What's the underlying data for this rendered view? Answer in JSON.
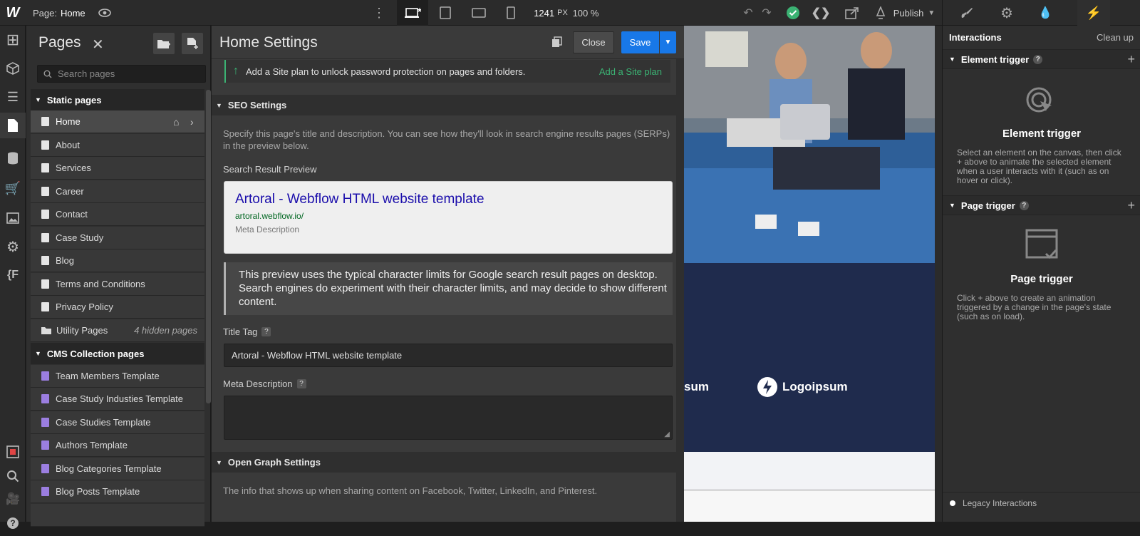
{
  "topbar": {
    "logo": "W",
    "page_label": "Page:",
    "page_name": "Home",
    "width_value": "1241",
    "width_unit": "PX",
    "zoom": "100 %",
    "publish": "Publish"
  },
  "pages_panel": {
    "title": "Pages",
    "search_placeholder": "Search pages",
    "static_section": "Static pages",
    "static_pages": [
      "Home",
      "About",
      "Services",
      "Career",
      "Contact",
      "Case Study",
      "Blog",
      "Terms and Conditions",
      "Privacy Policy"
    ],
    "utility_label": "Utility Pages",
    "utility_hidden": "4 hidden pages",
    "cms_section": "CMS Collection pages",
    "cms_pages": [
      "Team Members Template",
      "Case Study Industies Template",
      "Case Studies Template",
      "Authors Template",
      "Blog Categories Template",
      "Blog Posts Template"
    ]
  },
  "settings": {
    "title": "Home Settings",
    "close": "Close",
    "save": "Save",
    "banner_text": "Add a Site plan to unlock password protection on pages and folders.",
    "banner_link": "Add a Site plan",
    "seo_header": "SEO Settings",
    "seo_desc": "Specify this page's title and description. You can see how they'll look in search engine results pages (SERPs) in the preview below.",
    "preview_label": "Search Result Preview",
    "serp_title": "Artoral - Webflow HTML website template",
    "serp_url": "artoral.webflow.io/",
    "serp_meta": "Meta Description",
    "note": "This preview uses the typical character limits for Google search result pages on desktop. Search engines do experiment with their character limits, and may decide to show different content.",
    "title_tag_label": "Title Tag",
    "title_tag_value": "Artoral  - Webflow HTML website template",
    "meta_label": "Meta Description",
    "og_header": "Open Graph Settings",
    "og_desc": "The info that shows up when sharing content on Facebook, Twitter, LinkedIn, and Pinterest.",
    "help": "?"
  },
  "canvas": {
    "logo_partial": "sum",
    "logo": "Logoipsum"
  },
  "interactions": {
    "title": "Interactions",
    "clean_up": "Clean up",
    "element_trigger_header": "Element trigger",
    "element_trigger_title": "Element trigger",
    "element_trigger_desc": "Select an element on the canvas, then click + above to animate the selected element when a user interacts with it (such as on hover or click).",
    "page_trigger_header": "Page trigger",
    "page_trigger_title": "Page trigger",
    "page_trigger_desc": "Click + above to create an animation triggered by a change in the page's state (such as on load).",
    "legacy": "Legacy Interactions"
  }
}
